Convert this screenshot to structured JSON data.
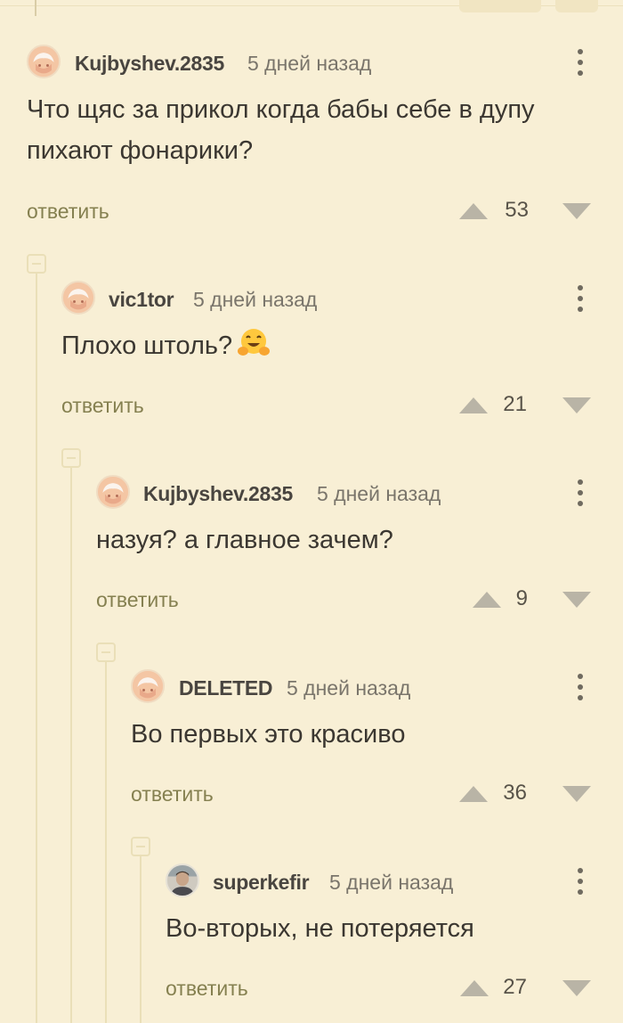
{
  "colors": {
    "background": "#f8efd5",
    "reply_link": "#858050",
    "thread_line": "#eadfb8"
  },
  "comments": [
    {
      "username": "Kujbyshev.2835",
      "time": "5 дней назад",
      "text_lines": [
        "Что щяс за прикол когда бабы себе в дупу",
        "пихают фонарики?"
      ],
      "reply_label": "ответить",
      "score": "53",
      "avatar_icon": "default-avatar-icon"
    },
    {
      "username": "vic1tor",
      "time": "5 дней назад",
      "text_lines": [
        "Плохо штоль?"
      ],
      "emoji": "hugging-face-emoji",
      "reply_label": "ответить",
      "score": "21",
      "avatar_icon": "default-avatar-icon"
    },
    {
      "username": "Kujbyshev.2835",
      "time": "5 дней назад",
      "text_lines": [
        "назуя? а главное зачем?"
      ],
      "reply_label": "ответить",
      "score": "9",
      "avatar_icon": "default-avatar-icon"
    },
    {
      "username": "DELETED",
      "time": "5 дней назад",
      "text_lines": [
        "Во первых это красиво"
      ],
      "reply_label": "ответить",
      "score": "36",
      "avatar_icon": "default-avatar-icon"
    },
    {
      "username": "superkefir",
      "time": "5 дней назад",
      "text_lines": [
        "Во-вторых, не потеряется"
      ],
      "reply_label": "ответить",
      "score": "27",
      "avatar_icon": "user-photo-avatar"
    }
  ]
}
